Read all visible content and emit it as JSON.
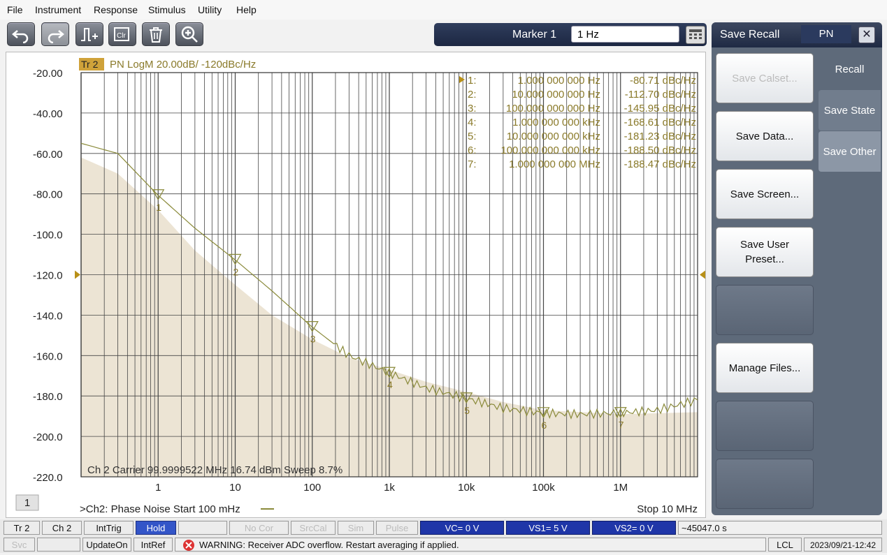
{
  "menu": [
    "File",
    "Instrument",
    "Response",
    "Stimulus",
    "Utility",
    "Help"
  ],
  "toolbar_icons": [
    "undo-icon",
    "redo-icon",
    "marker-add-icon",
    "clear-icon",
    "delete-icon",
    "zoom-icon"
  ],
  "marker": {
    "label": "Marker 1",
    "value": "1 Hz"
  },
  "trace": {
    "tag": "Tr 2",
    "title": "PN LogM 20.00dB/  -120dBc/Hz"
  },
  "chart_data": {
    "type": "line",
    "x_scale": "log",
    "xlim": [
      0.1,
      10000000
    ],
    "ylim": [
      -220,
      -20
    ],
    "y_ticks": [
      "-20.00",
      "-40.00",
      "-60.00",
      "-80.00",
      "-100.0",
      "-120.0",
      "-140.0",
      "-160.0",
      "-180.0",
      "-200.0",
      "-220.0"
    ],
    "x_ticks": [
      "1",
      "10",
      "100",
      "1k",
      "10k",
      "100k",
      "1M"
    ],
    "reference_level": -120,
    "series": [
      {
        "values_x": [
          0.1,
          0.3,
          1,
          3,
          10,
          30,
          100,
          300,
          1000,
          3000,
          10000,
          30000,
          100000,
          300000,
          1000000,
          3000000,
          10000000
        ],
        "values_y": [
          -55,
          -60,
          -80.71,
          -97,
          -112.7,
          -128,
          -145.95,
          -160,
          -168.61,
          -176,
          -181.23,
          -186,
          -188.5,
          -189,
          -188.47,
          -187,
          -182
        ]
      }
    ],
    "noise_floor": {
      "x": [
        0.1,
        0.3,
        1,
        3,
        10,
        30,
        100,
        300,
        1000,
        3000,
        10000,
        30000,
        100000,
        1000000,
        10000000
      ],
      "y": [
        -62,
        -70,
        -88,
        -108,
        -125,
        -140,
        -152,
        -161,
        -167,
        -173,
        -178,
        -183,
        -187,
        -189,
        -188
      ]
    },
    "markers": [
      {
        "id": "1",
        "x": 1,
        "y": -80.71
      },
      {
        "id": "2",
        "x": 10,
        "y": -112.7
      },
      {
        "id": "3",
        "x": 100,
        "y": -145.95
      },
      {
        "id": "4",
        "x": 1000,
        "y": -168.61
      },
      {
        "id": "5",
        "x": 10000,
        "y": -181.23
      },
      {
        "id": "6",
        "x": 100000,
        "y": -188.5
      },
      {
        "id": "7",
        "x": 1000000,
        "y": -188.47
      }
    ],
    "marker_table": [
      {
        "n": "1:",
        "freq": "1.000 000 000 Hz",
        "val": "-80.71 dBc/Hz"
      },
      {
        "n": "2:",
        "freq": "10.000 000 000 Hz",
        "val": "-112.70 dBc/Hz"
      },
      {
        "n": "3:",
        "freq": "100.000 000 000 Hz",
        "val": "-145.95 dBc/Hz"
      },
      {
        "n": "4:",
        "freq": "1.000 000 000 kHz",
        "val": "-168.61 dBc/Hz"
      },
      {
        "n": "5:",
        "freq": "10.000 000 000 kHz",
        "val": "-181.23 dBc/Hz"
      },
      {
        "n": "6:",
        "freq": "100.000 000 000 kHz",
        "val": "-188.50 dBc/Hz"
      },
      {
        "n": "7:",
        "freq": "1.000 000 000 MHz",
        "val": "-188.47 dBc/Hz"
      }
    ],
    "carrier_info": "Ch 2  Carrier 99.9999522 MHz    16.74 dBm    Sweep 8.7%",
    "footer_left": ">Ch2: Phase Noise  Start  100 mHz",
    "footer_right": "Stop  10 MHz",
    "channel_number": "1",
    "colors": {
      "trace": "#8a8a3a",
      "text": "#8a7a2a",
      "fill": "#ece4d4",
      "ref": "#b89018"
    }
  },
  "side": {
    "title": "Save Recall",
    "tag": "PN",
    "close": "✕",
    "buttons": [
      "Save Calset...",
      "Save Data...",
      "Save Screen...",
      "Save User Preset...",
      "",
      "Manage Files...",
      "",
      ""
    ],
    "tabs": [
      "Recall",
      "Save State",
      "Save Other"
    ]
  },
  "status1": [
    "Tr 2",
    "Ch 2",
    "IntTrig",
    "Hold",
    "",
    "No Cor",
    "SrcCal",
    "Sim",
    "Pulse",
    "VC= 0 V",
    "VS1= 5 V",
    "VS2= 0 V",
    "~45047.0 s"
  ],
  "status2": {
    "svc": "Svc",
    "update": "UpdateOn",
    "intref": "IntRef",
    "warning": "WARNING: Receiver  ADC overflow. Restart averaging if applied.",
    "lcl": "LCL",
    "datetime": "2023/09/21-12:42"
  }
}
